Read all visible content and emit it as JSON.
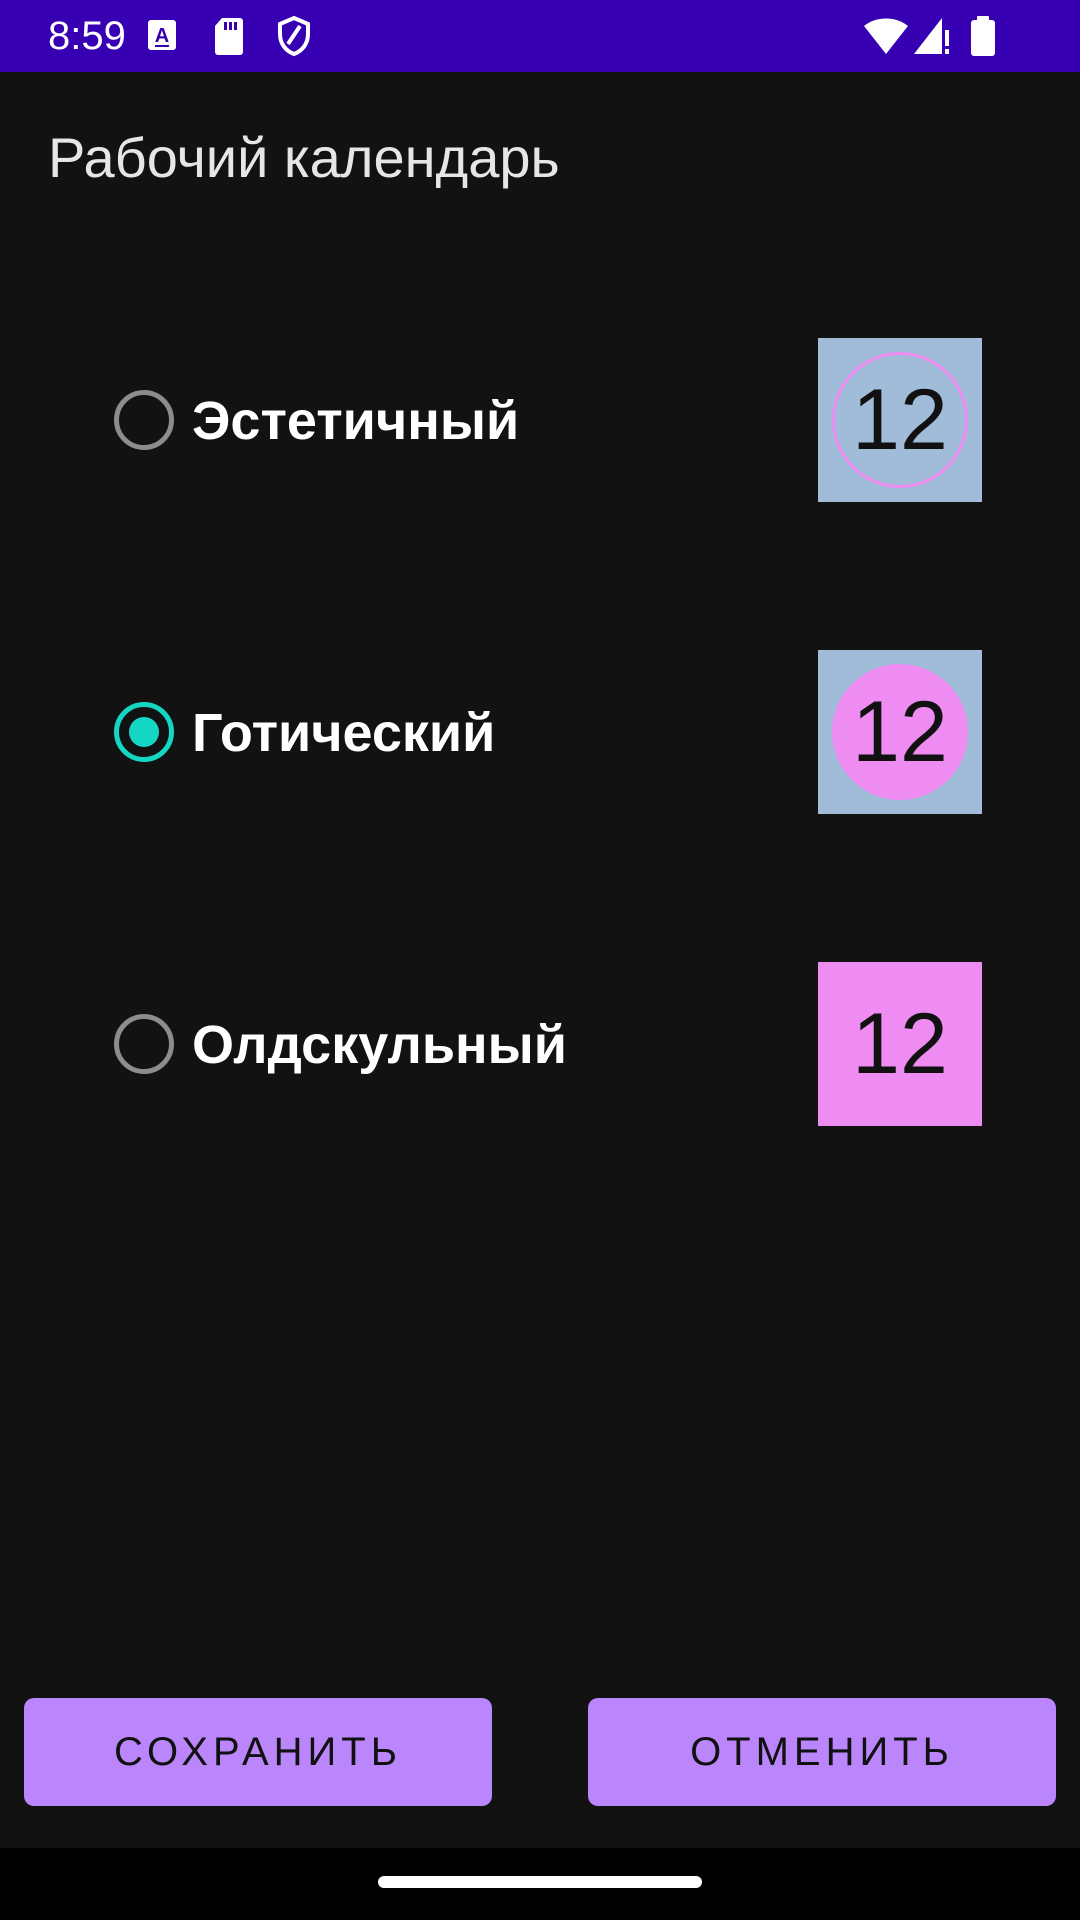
{
  "status_bar": {
    "time": "8:59",
    "background": "#3700b3",
    "left_icons": [
      "keyboard-a-icon",
      "sd-card-icon",
      "shield-icon"
    ],
    "right_icons": [
      "wifi-icon",
      "signal-icon",
      "battery-icon"
    ]
  },
  "page": {
    "title": "Рабочий календарь"
  },
  "options": [
    {
      "label": "Эстетичный",
      "checked": false,
      "preview_number": "12",
      "preview_style": "outlined-circle",
      "preview_bg": "#a0bcd8",
      "preview_accent": "#ee8cf2"
    },
    {
      "label": "Готический",
      "checked": true,
      "preview_number": "12",
      "preview_style": "filled-circle",
      "preview_bg": "#a0bcd8",
      "preview_accent": "#ee8cf2"
    },
    {
      "label": "Олдскульный",
      "checked": false,
      "preview_number": "12",
      "preview_style": "filled-square",
      "preview_bg": "#ee8cf2",
      "preview_accent": "#ee8cf2"
    }
  ],
  "buttons": {
    "save_label": "СОХРАНИТЬ",
    "cancel_label": "ОТМЕНИТЬ",
    "color": "#bb86fc"
  },
  "colors": {
    "background": "#121212",
    "radio_checked": "#15d6c2",
    "radio_unchecked": "#8d8d8d"
  }
}
